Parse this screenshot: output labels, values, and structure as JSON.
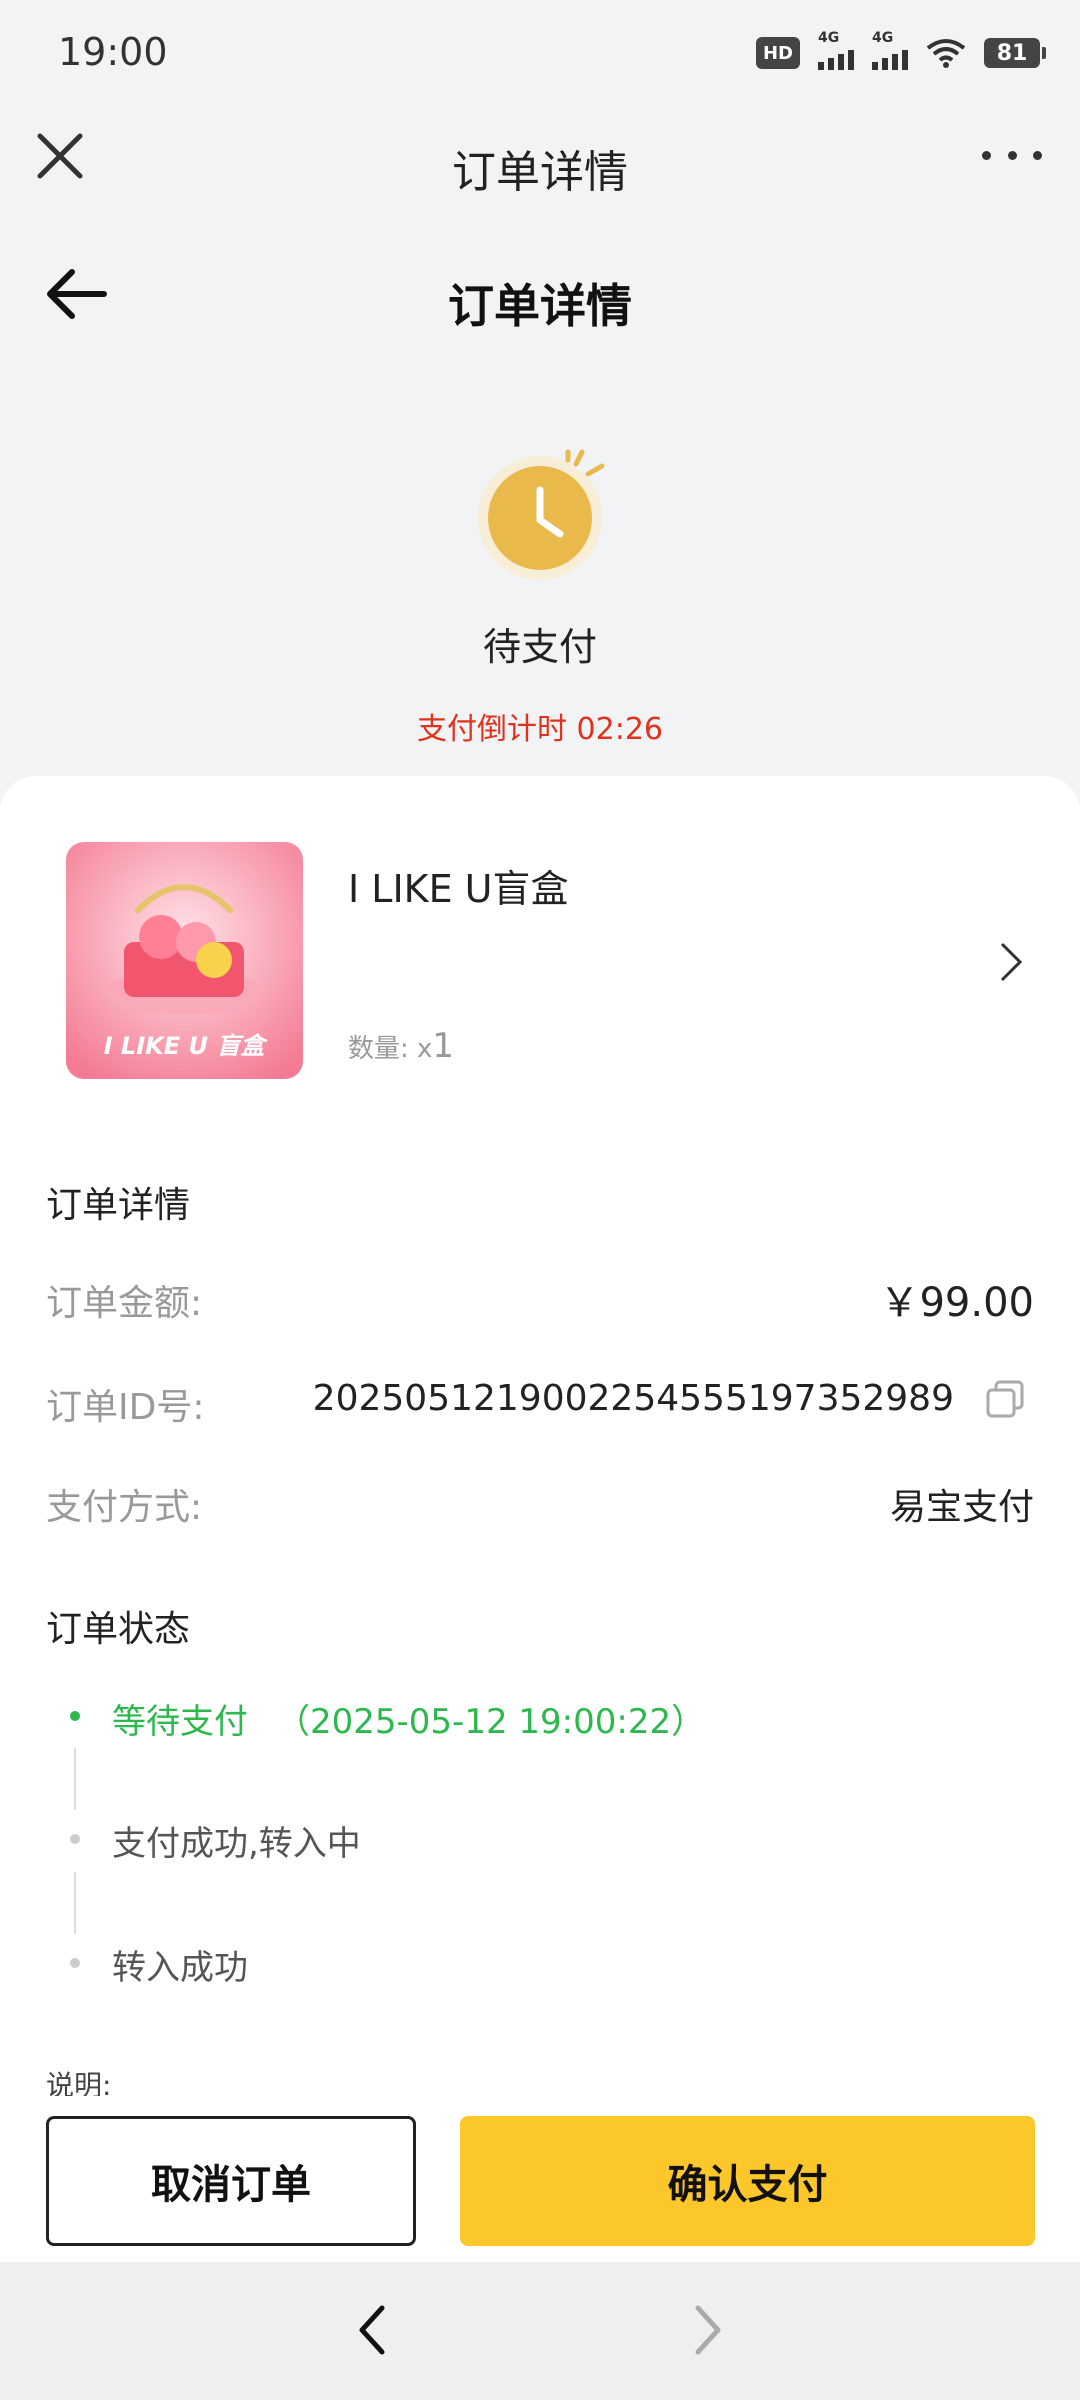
{
  "status_bar": {
    "time": "19:00",
    "hd": "HD",
    "net1": "4G",
    "net2": "4G",
    "battery": "81"
  },
  "webview": {
    "title": "订单详情"
  },
  "header": {
    "title": "订单详情"
  },
  "order_status": {
    "label": "待支付",
    "countdown": "支付倒计时 02:26"
  },
  "product": {
    "name": "I LIKE U盲盒",
    "qty_label": "数量:",
    "qty_prefix": "x",
    "qty_value": "1",
    "thumb_text": "I LIKE U 盲盒"
  },
  "details": {
    "heading": "订单详情",
    "rows": [
      {
        "label": "订单金额:",
        "value": "￥99.00"
      },
      {
        "label": "订单ID号:",
        "value": "2025051219002254555197352989"
      },
      {
        "label": "支付方式:",
        "value": "易宝支付"
      }
    ]
  },
  "status_section": {
    "heading": "订单状态",
    "steps": [
      {
        "text": "等待支付",
        "time": "（2025-05-12 19:00:22）",
        "active": true
      },
      {
        "text": "支付成功,转入中",
        "active": false
      },
      {
        "text": "转入成功",
        "active": false
      }
    ]
  },
  "note": "说明:",
  "actions": {
    "cancel": "取消订单",
    "confirm": "确认支付"
  },
  "colors": {
    "accent": "#fcc72a",
    "countdown": "#e0321d",
    "active_step": "#2db84d"
  }
}
